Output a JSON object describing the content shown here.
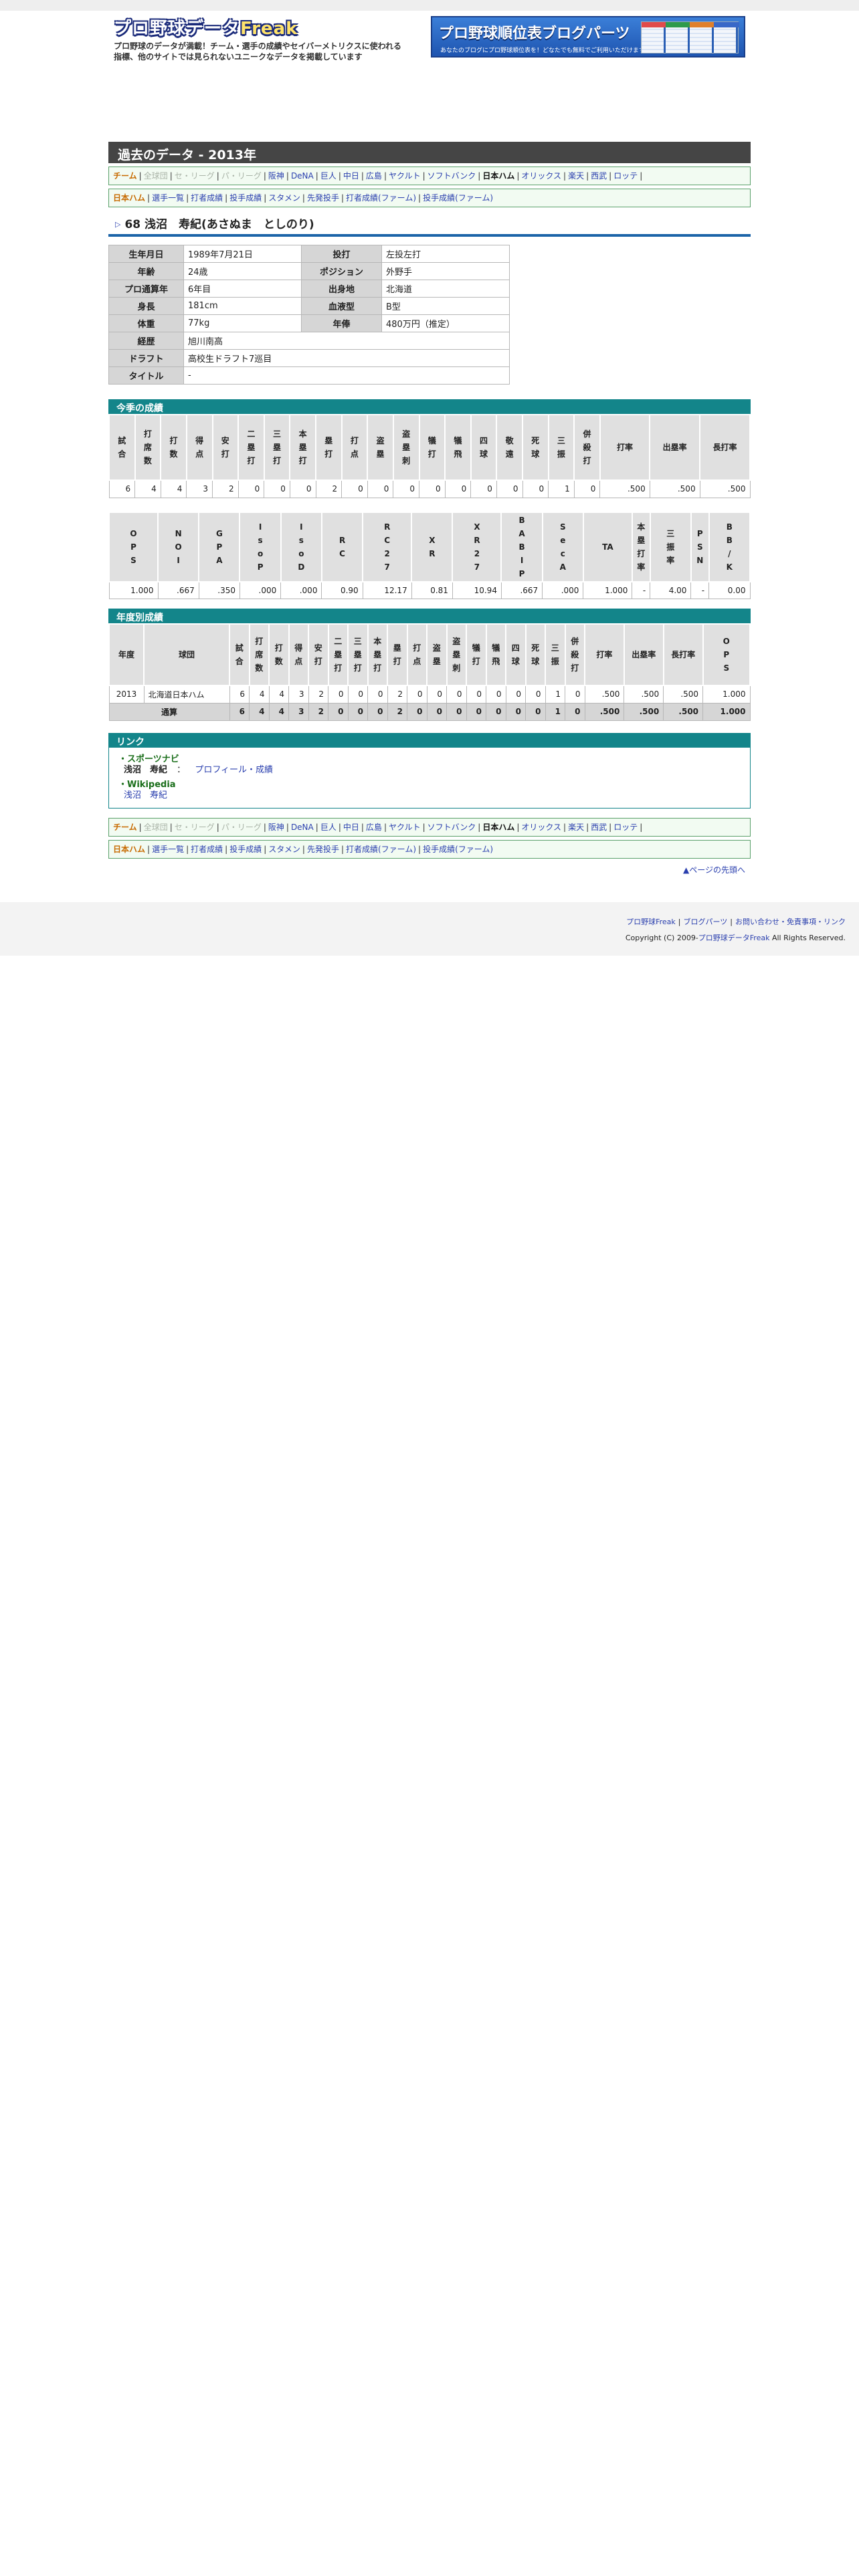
{
  "header": {
    "logo": "プロ野球データFreak",
    "logo_plain": "プロ野球データ",
    "logo_accent": "Freak",
    "tagline_1": "プロ野球のデータが満載！チーム・選手の成績やセイバーメトリクスに使われる",
    "tagline_2": "指標、他のサイトでは見られないユニークなデータを掲載しています",
    "banner_title": "プロ野球順位表ブログパーツ",
    "banner_sub": "あなたのブログにプロ野球順位表を！どなたでも無料でご利用いただけます"
  },
  "page_title": "過去のデータ - 2013年",
  "team_nav": {
    "label": "チーム",
    "items": [
      "全球団",
      "セ・リーグ",
      "パ・リーグ",
      "阪神",
      "DeNA",
      "巨人",
      "中日",
      "広島",
      "ヤクルト",
      "ソフトバンク",
      "日本ハム",
      "オリックス",
      "楽天",
      "西武",
      "ロッテ"
    ]
  },
  "sub_nav": {
    "label": "日本ハム",
    "items": [
      "選手一覧",
      "打者成績",
      "投手成績",
      "スタメン",
      "先発投手",
      "打者成績(ファーム)",
      "投手成績(ファーム)"
    ]
  },
  "player": {
    "number_name": "68 浅沼　寿紀(あさぬま　としのり)",
    "profile": [
      {
        "k1": "生年月日",
        "v1": "1989年7月21日",
        "k2": "投打",
        "v2": "左投左打"
      },
      {
        "k1": "年齢",
        "v1": "24歳",
        "k2": "ポジション",
        "v2": "外野手"
      },
      {
        "k1": "プロ通算年",
        "v1": "6年目",
        "k2": "出身地",
        "v2": "北海道"
      },
      {
        "k1": "身長",
        "v1": "181cm",
        "k2": "血液型",
        "v2": "B型"
      },
      {
        "k1": "体重",
        "v1": "77kg",
        "k2": "年俸",
        "v2": "480万円（推定）"
      }
    ],
    "career": {
      "k": "経歴",
      "v": "旭川南高"
    },
    "draft": {
      "k": "ドラフト",
      "v": "高校生ドラフト7巡目"
    },
    "titles": {
      "k": "タイトル",
      "v": "-"
    }
  },
  "season": {
    "heading": "今季の成績",
    "headers1": [
      "試合",
      "打席数",
      "打数",
      "得点",
      "安打",
      "二塁打",
      "三塁打",
      "本塁打",
      "塁打",
      "打点",
      "盗塁",
      "盗塁刺",
      "犠打",
      "犠飛",
      "四球",
      "敬遠",
      "死球",
      "三振",
      "併殺打",
      "打率",
      "出塁率",
      "長打率"
    ],
    "values1": [
      "6",
      "4",
      "4",
      "3",
      "2",
      "0",
      "0",
      "0",
      "2",
      "0",
      "0",
      "0",
      "0",
      "0",
      "0",
      "0",
      "0",
      "1",
      "0",
      ".500",
      ".500",
      ".500"
    ],
    "headers2": [
      "OPS",
      "NOI",
      "GPA",
      "IsoP",
      "IsoD",
      "RC",
      "RC27",
      "XR",
      "XR27",
      "BABIP",
      "SecA",
      "TA",
      "本塁打率",
      "三振率",
      "PSN",
      "BB/K"
    ],
    "values2": [
      "1.000",
      ".667",
      ".350",
      ".000",
      ".000",
      "0.90",
      "12.17",
      "0.81",
      "10.94",
      ".667",
      ".000",
      "1.000",
      "-",
      "4.00",
      "-",
      "0.00"
    ]
  },
  "yearly": {
    "heading": "年度別成績",
    "headers": [
      "年度",
      "球団",
      "試合",
      "打席数",
      "打数",
      "得点",
      "安打",
      "二塁打",
      "三塁打",
      "本塁打",
      "塁打",
      "打点",
      "盗塁",
      "盗塁刺",
      "犠打",
      "犠飛",
      "四球",
      "死球",
      "三振",
      "併殺打",
      "打率",
      "出塁率",
      "長打率",
      "OPS"
    ],
    "row": [
      "2013",
      "北海道日本ハム",
      "6",
      "4",
      "4",
      "3",
      "2",
      "0",
      "0",
      "0",
      "2",
      "0",
      "0",
      "0",
      "0",
      "0",
      "0",
      "0",
      "1",
      "0",
      ".500",
      ".500",
      ".500",
      "1.000"
    ],
    "total": [
      "通算",
      "6",
      "4",
      "4",
      "3",
      "2",
      "0",
      "0",
      "0",
      "2",
      "0",
      "0",
      "0",
      "0",
      "0",
      "0",
      "0",
      "1",
      "0",
      ".500",
      ".500",
      ".500",
      "1.000"
    ]
  },
  "links": {
    "heading": "リンク",
    "site1": "・スポーツナビ",
    "site1_name": "浅沼　寿紀",
    "site1_colon": "：",
    "site1_link": "プロフィール・成績",
    "site2": "・Wikipedia",
    "site2_link": "浅沼　寿紀"
  },
  "pagetop": "▲ページの先頭へ",
  "footer": {
    "links": [
      "プロ野球Freak",
      "ブログパーツ",
      "お問い合わせ・免責事項・リンク"
    ],
    "copy_pre": "Copyright (C) 2009-",
    "copy_link": "プロ野球データFreak",
    "copy_post": " All Rights Reserved."
  },
  "colors": {
    "title_bar": "#454545",
    "section": "#13858a",
    "nav_border": "#5aa06a",
    "link": "#2a3fae",
    "accent_rule": "#1b64a8"
  }
}
